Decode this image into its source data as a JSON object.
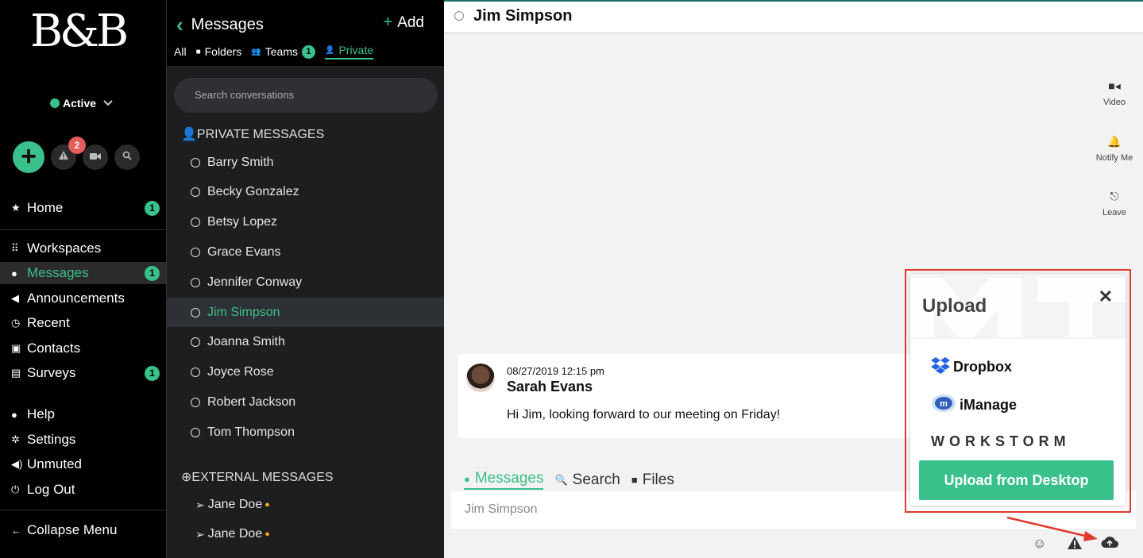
{
  "app": {
    "logo": "B&B"
  },
  "status": {
    "label": "Active"
  },
  "quick_actions": {
    "alerts_count": "2"
  },
  "nav": {
    "home": {
      "label": "Home",
      "badge": "1"
    },
    "workspaces": {
      "label": "Workspaces"
    },
    "messages": {
      "label": "Messages",
      "badge": "1"
    },
    "announcements": {
      "label": "Announcements"
    },
    "recent": {
      "label": "Recent"
    },
    "contacts": {
      "label": "Contacts"
    },
    "surveys": {
      "label": "Surveys",
      "badge": "1"
    },
    "help": {
      "label": "Help"
    },
    "settings": {
      "label": "Settings"
    },
    "unmuted": {
      "label": "Unmuted"
    },
    "logout": {
      "label": "Log Out"
    },
    "collapse": {
      "label": "Collapse Menu"
    }
  },
  "messages_panel": {
    "title": "Messages",
    "add_label": "Add",
    "tabs": {
      "all": "All",
      "folders": "Folders",
      "teams": "Teams",
      "teams_badge": "1",
      "private": "Private"
    },
    "search_placeholder": "Search conversations",
    "private_title": "PRIVATE MESSAGES",
    "conversations": [
      "Barry Smith",
      "Becky Gonzalez",
      "Betsy Lopez",
      "Grace Evans",
      "Jennifer Conway",
      "Jim Simpson",
      "Joanna Smith",
      "Joyce Rose",
      "Robert Jackson",
      "Tom Thompson"
    ],
    "active_conversation": "Jim Simpson",
    "external_title": "EXTERNAL MESSAGES",
    "external": [
      "Jane Doe",
      "Jane Doe"
    ]
  },
  "chat": {
    "title": "Jim Simpson",
    "actions": {
      "video": "Video",
      "notify": "Notify Me",
      "leave": "Leave"
    },
    "message": {
      "timestamp": "08/27/2019 12:15 pm",
      "author": "Sarah Evans",
      "text": "Hi Jim, looking forward to our meeting on Friday!"
    },
    "tabs": {
      "messages": "Messages",
      "search": "Search",
      "files": "Files"
    },
    "compose_placeholder": "Jim Simpson"
  },
  "upload": {
    "title": "Upload",
    "dropbox": "Dropbox",
    "imanage": "iManage",
    "workstorm": "WORKSTORM",
    "desktop_button": "Upload from Desktop"
  },
  "colors": {
    "accent": "#3ac08a",
    "alert": "#e55c5c",
    "highlight": "#e03a2f"
  }
}
